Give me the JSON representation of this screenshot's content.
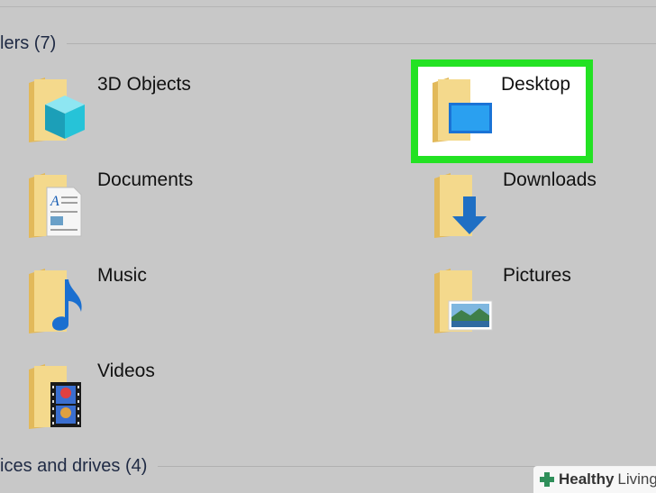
{
  "sections": {
    "folders": {
      "title": "lers (7)"
    },
    "devices": {
      "title": "ices and drives (4)"
    }
  },
  "folders": [
    {
      "label": "3D Objects",
      "icon": "3d-objects-folder-icon"
    },
    {
      "label": "Desktop",
      "icon": "desktop-folder-icon",
      "selected": true
    },
    {
      "label": "Documents",
      "icon": "documents-folder-icon"
    },
    {
      "label": "Downloads",
      "icon": "downloads-folder-icon"
    },
    {
      "label": "Music",
      "icon": "music-folder-icon"
    },
    {
      "label": "Pictures",
      "icon": "pictures-folder-icon"
    },
    {
      "label": "Videos",
      "icon": "videos-folder-icon"
    }
  ],
  "watermark": {
    "brand": "Healthy",
    "living": "Living"
  },
  "colors": {
    "highlight": "#23e223",
    "folder": "#f2d27a",
    "background": "#c8c8c8"
  }
}
